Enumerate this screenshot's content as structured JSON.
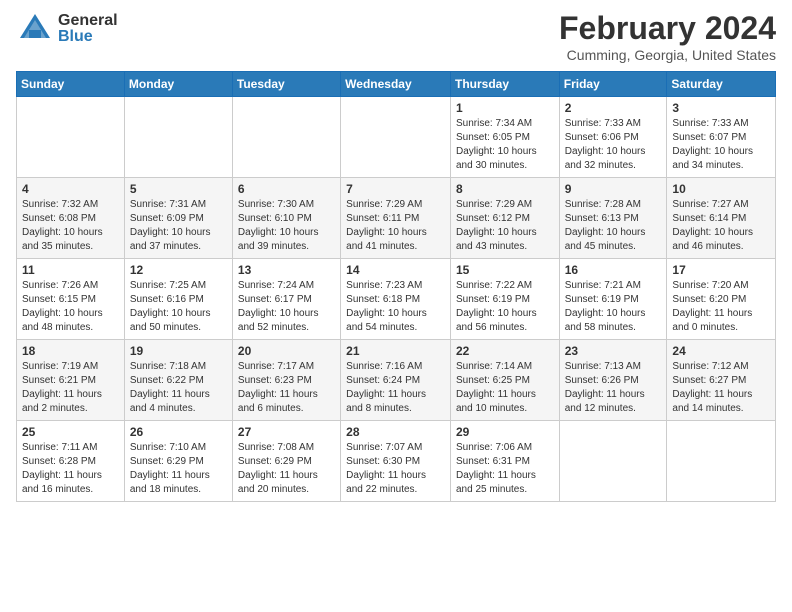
{
  "header": {
    "logo_general": "General",
    "logo_blue": "Blue",
    "month_title": "February 2024",
    "location": "Cumming, Georgia, United States"
  },
  "days_of_week": [
    "Sunday",
    "Monday",
    "Tuesday",
    "Wednesday",
    "Thursday",
    "Friday",
    "Saturday"
  ],
  "weeks": [
    [
      {
        "day": "",
        "info": ""
      },
      {
        "day": "",
        "info": ""
      },
      {
        "day": "",
        "info": ""
      },
      {
        "day": "",
        "info": ""
      },
      {
        "day": "1",
        "info": "Sunrise: 7:34 AM\nSunset: 6:05 PM\nDaylight: 10 hours\nand 30 minutes."
      },
      {
        "day": "2",
        "info": "Sunrise: 7:33 AM\nSunset: 6:06 PM\nDaylight: 10 hours\nand 32 minutes."
      },
      {
        "day": "3",
        "info": "Sunrise: 7:33 AM\nSunset: 6:07 PM\nDaylight: 10 hours\nand 34 minutes."
      }
    ],
    [
      {
        "day": "4",
        "info": "Sunrise: 7:32 AM\nSunset: 6:08 PM\nDaylight: 10 hours\nand 35 minutes."
      },
      {
        "day": "5",
        "info": "Sunrise: 7:31 AM\nSunset: 6:09 PM\nDaylight: 10 hours\nand 37 minutes."
      },
      {
        "day": "6",
        "info": "Sunrise: 7:30 AM\nSunset: 6:10 PM\nDaylight: 10 hours\nand 39 minutes."
      },
      {
        "day": "7",
        "info": "Sunrise: 7:29 AM\nSunset: 6:11 PM\nDaylight: 10 hours\nand 41 minutes."
      },
      {
        "day": "8",
        "info": "Sunrise: 7:29 AM\nSunset: 6:12 PM\nDaylight: 10 hours\nand 43 minutes."
      },
      {
        "day": "9",
        "info": "Sunrise: 7:28 AM\nSunset: 6:13 PM\nDaylight: 10 hours\nand 45 minutes."
      },
      {
        "day": "10",
        "info": "Sunrise: 7:27 AM\nSunset: 6:14 PM\nDaylight: 10 hours\nand 46 minutes."
      }
    ],
    [
      {
        "day": "11",
        "info": "Sunrise: 7:26 AM\nSunset: 6:15 PM\nDaylight: 10 hours\nand 48 minutes."
      },
      {
        "day": "12",
        "info": "Sunrise: 7:25 AM\nSunset: 6:16 PM\nDaylight: 10 hours\nand 50 minutes."
      },
      {
        "day": "13",
        "info": "Sunrise: 7:24 AM\nSunset: 6:17 PM\nDaylight: 10 hours\nand 52 minutes."
      },
      {
        "day": "14",
        "info": "Sunrise: 7:23 AM\nSunset: 6:18 PM\nDaylight: 10 hours\nand 54 minutes."
      },
      {
        "day": "15",
        "info": "Sunrise: 7:22 AM\nSunset: 6:19 PM\nDaylight: 10 hours\nand 56 minutes."
      },
      {
        "day": "16",
        "info": "Sunrise: 7:21 AM\nSunset: 6:19 PM\nDaylight: 10 hours\nand 58 minutes."
      },
      {
        "day": "17",
        "info": "Sunrise: 7:20 AM\nSunset: 6:20 PM\nDaylight: 11 hours\nand 0 minutes."
      }
    ],
    [
      {
        "day": "18",
        "info": "Sunrise: 7:19 AM\nSunset: 6:21 PM\nDaylight: 11 hours\nand 2 minutes."
      },
      {
        "day": "19",
        "info": "Sunrise: 7:18 AM\nSunset: 6:22 PM\nDaylight: 11 hours\nand 4 minutes."
      },
      {
        "day": "20",
        "info": "Sunrise: 7:17 AM\nSunset: 6:23 PM\nDaylight: 11 hours\nand 6 minutes."
      },
      {
        "day": "21",
        "info": "Sunrise: 7:16 AM\nSunset: 6:24 PM\nDaylight: 11 hours\nand 8 minutes."
      },
      {
        "day": "22",
        "info": "Sunrise: 7:14 AM\nSunset: 6:25 PM\nDaylight: 11 hours\nand 10 minutes."
      },
      {
        "day": "23",
        "info": "Sunrise: 7:13 AM\nSunset: 6:26 PM\nDaylight: 11 hours\nand 12 minutes."
      },
      {
        "day": "24",
        "info": "Sunrise: 7:12 AM\nSunset: 6:27 PM\nDaylight: 11 hours\nand 14 minutes."
      }
    ],
    [
      {
        "day": "25",
        "info": "Sunrise: 7:11 AM\nSunset: 6:28 PM\nDaylight: 11 hours\nand 16 minutes."
      },
      {
        "day": "26",
        "info": "Sunrise: 7:10 AM\nSunset: 6:29 PM\nDaylight: 11 hours\nand 18 minutes."
      },
      {
        "day": "27",
        "info": "Sunrise: 7:08 AM\nSunset: 6:29 PM\nDaylight: 11 hours\nand 20 minutes."
      },
      {
        "day": "28",
        "info": "Sunrise: 7:07 AM\nSunset: 6:30 PM\nDaylight: 11 hours\nand 22 minutes."
      },
      {
        "day": "29",
        "info": "Sunrise: 7:06 AM\nSunset: 6:31 PM\nDaylight: 11 hours\nand 25 minutes."
      },
      {
        "day": "",
        "info": ""
      },
      {
        "day": "",
        "info": ""
      }
    ]
  ]
}
